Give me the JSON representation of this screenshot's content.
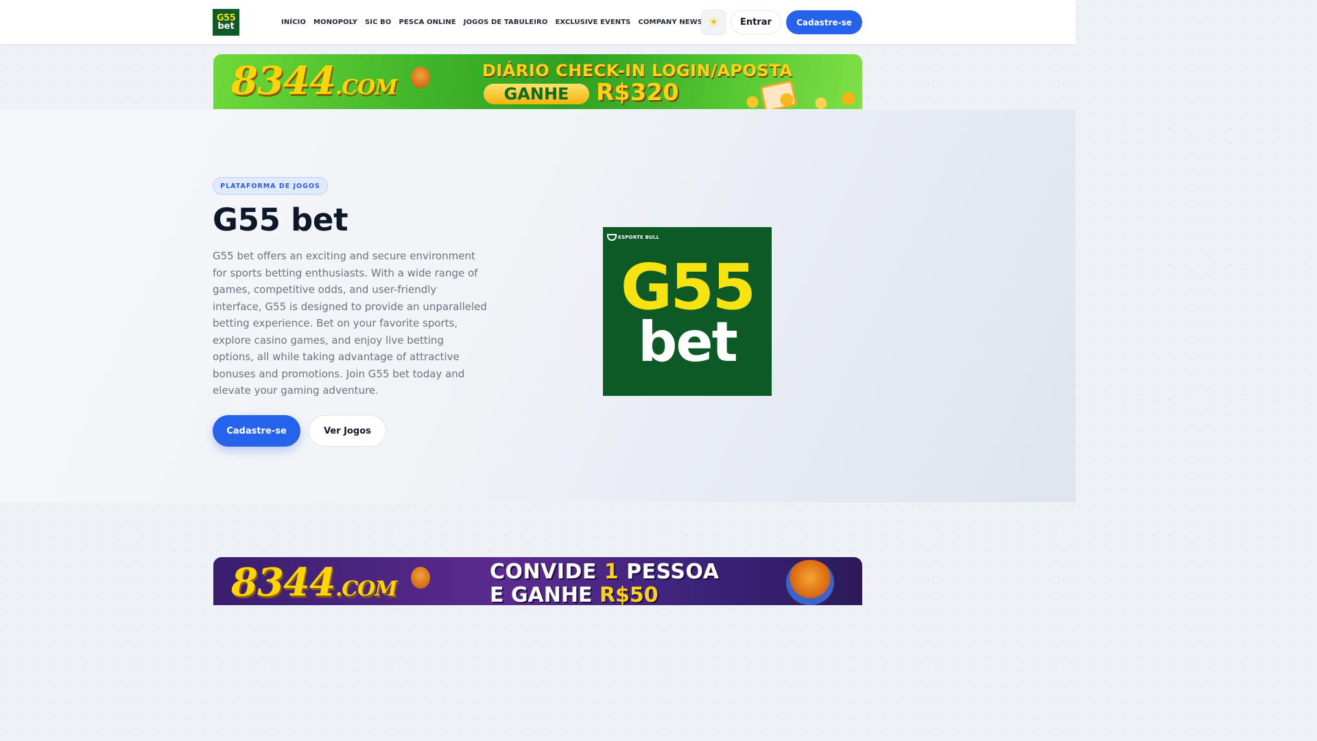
{
  "header": {
    "logo_line1": "G55",
    "logo_line2": "bet",
    "nav": [
      "INÍCIO",
      "MONOPOLY",
      "SIC BO",
      "PESCA ONLINE",
      "JOGOS DE TABULEIRO",
      "EXCLUSIVE EVENTS",
      "COMPANY NEWS"
    ],
    "theme_icon": "sun-icon",
    "login_label": "Entrar",
    "signup_label": "Cadastre-se"
  },
  "banner_top": {
    "site": "8344",
    "site_suffix": ".COM",
    "line1": "DIÁRIO CHECK-IN LOGIN/APOSTA",
    "pill": "GANHE",
    "amount": "R$320"
  },
  "hero": {
    "badge": "PLATAFORMA DE JOGOS",
    "title": "G55 bet",
    "description": "G55 bet offers an exciting and secure environment for sports betting enthusiasts. With a wide range of games, competitive odds, and user-friendly interface, G55 is designed to provide an unparalleled betting experience. Bet on your favorite sports, explore casino games, and enjoy live betting options, all while taking advantage of attractive bonuses and promotions. Join G55 bet today and elevate your gaming adventure.",
    "primary_button": "Cadastre-se",
    "secondary_button": "Ver Jogos",
    "image": {
      "brand": "ESPORTE BULL",
      "g55": "G55",
      "bet": "bet"
    }
  },
  "banner_bottom": {
    "site": "8344",
    "site_suffix": ".COM",
    "line1_a": "CONVIDE ",
    "line1_hl": "1",
    "line1_b": " PESSOA",
    "line2_a": "E GANHE ",
    "line2_hl": "R$50"
  },
  "colors": {
    "accent": "#2563eb",
    "brand_green": "#0e5a27",
    "brand_yellow": "#f6e311"
  }
}
